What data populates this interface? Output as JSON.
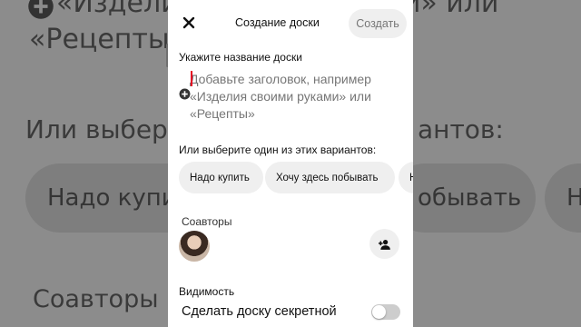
{
  "background": {
    "top_line": "«Изделия своими руками» или",
    "second_line": "«Рецепты»",
    "choose_line": "Или выбери",
    "choose_line_right": "антов:",
    "chip_left": "Надо купи",
    "chip_right": "обывать",
    "chip_right_far": "Н",
    "coauthors": "Соавторы"
  },
  "header": {
    "title": "Создание доски",
    "create_label": "Создать"
  },
  "form": {
    "name_label": "Укажите название доски",
    "name_placeholder_line1": "Добавьте заголовок, например",
    "name_placeholder_line2": "«Изделия своими руками» или",
    "name_placeholder_line3": "«Рецепты»",
    "choose_label": "Или выберите один из этих вариантов:",
    "chips": [
      "Надо купить",
      "Хочу здесь побывать",
      "Н"
    ],
    "coauthors_label": "Соавторы",
    "visibility_label": "Видимость",
    "secret_label": "Сделать доску секретной",
    "secret_enabled": false
  },
  "colors": {
    "accent_caret": "#e60023",
    "chip_bg": "#efefef",
    "create_text": "#767676"
  }
}
